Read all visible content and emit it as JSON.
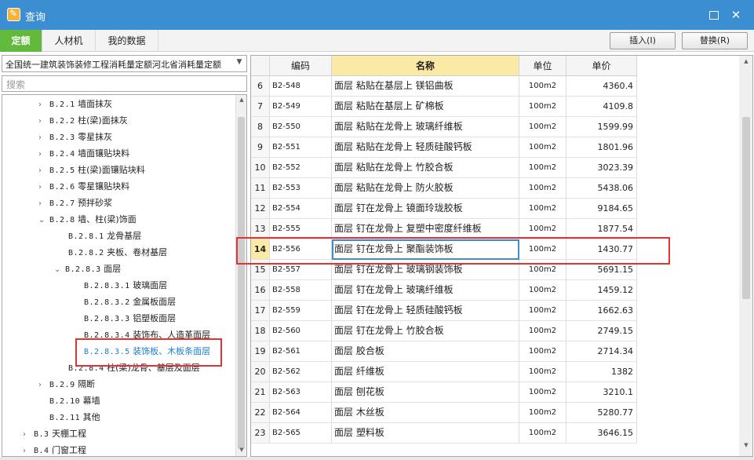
{
  "window": {
    "title": "查询"
  },
  "tabs": [
    {
      "label": "定额"
    },
    {
      "label": "人材机"
    },
    {
      "label": "我的数据"
    }
  ],
  "buttons": {
    "insert": "插入(I)",
    "replace": "替换(R)"
  },
  "combo": {
    "value": "全国统一建筑装饰装修工程消耗量定额河北省消耗量定额"
  },
  "search": {
    "placeholder": "搜索"
  },
  "tree": {
    "items": [
      {
        "code": "B.2.1",
        "label": "墙面抹灰"
      },
      {
        "code": "B.2.2",
        "label": "柱(梁)面抹灰"
      },
      {
        "code": "B.2.3",
        "label": "零星抹灰"
      },
      {
        "code": "B.2.4",
        "label": "墙面镶贴块料"
      },
      {
        "code": "B.2.5",
        "label": "柱(梁)面镶贴块料"
      },
      {
        "code": "B.2.6",
        "label": "零星镶贴块料"
      },
      {
        "code": "B.2.7",
        "label": "预拌砂浆"
      },
      {
        "code": "B.2.8",
        "label": "墙、柱(梁)饰面"
      },
      {
        "code": "B.2.8.1",
        "label": "龙骨基层"
      },
      {
        "code": "B.2.8.2",
        "label": "夹板、卷材基层"
      },
      {
        "code": "B.2.8.3",
        "label": "面层"
      },
      {
        "code": "B.2.8.3.1",
        "label": "玻璃面层"
      },
      {
        "code": "B.2.8.3.2",
        "label": "金属板面层"
      },
      {
        "code": "B.2.8.3.3",
        "label": "铝塑板面层"
      },
      {
        "code": "B.2.8.3.4",
        "label": "装饰布、人造革面层"
      },
      {
        "code": "B.2.8.3.5",
        "label": "装饰板、木板条面层"
      },
      {
        "code": "B.2.8.4",
        "label": "柱(梁)龙骨、基层及面层"
      },
      {
        "code": "B.2.9",
        "label": "隔断"
      },
      {
        "code": "B.2.10",
        "label": "幕墙"
      },
      {
        "code": "B.2.11",
        "label": "其他"
      },
      {
        "code": "B.3",
        "label": "天棚工程"
      },
      {
        "code": "B.4",
        "label": "门窗工程"
      }
    ]
  },
  "grid": {
    "headers": {
      "code": "编码",
      "name": "名称",
      "unit": "单位",
      "price": "单价"
    },
    "rows": [
      {
        "num": "6",
        "code": "B2-548",
        "name": "面层 粘贴在基层上 镁铝曲板",
        "unit": "100m2",
        "price": "4360.4"
      },
      {
        "num": "7",
        "code": "B2-549",
        "name": "面层 粘贴在基层上 矿棉板",
        "unit": "100m2",
        "price": "4109.8"
      },
      {
        "num": "8",
        "code": "B2-550",
        "name": "面层 粘贴在龙骨上 玻璃纤维板",
        "unit": "100m2",
        "price": "1599.99"
      },
      {
        "num": "9",
        "code": "B2-551",
        "name": "面层 粘贴在龙骨上 轻质硅酸钙板",
        "unit": "100m2",
        "price": "1801.96"
      },
      {
        "num": "10",
        "code": "B2-552",
        "name": "面层 粘贴在龙骨上 竹胶合板",
        "unit": "100m2",
        "price": "3023.39"
      },
      {
        "num": "11",
        "code": "B2-553",
        "name": "面层 粘贴在龙骨上 防火胶板",
        "unit": "100m2",
        "price": "5438.06"
      },
      {
        "num": "12",
        "code": "B2-554",
        "name": "面层 钉在龙骨上 镜面玲珑胶板",
        "unit": "100m2",
        "price": "9184.65"
      },
      {
        "num": "13",
        "code": "B2-555",
        "name": "面层 钉在龙骨上 复塑中密度纤维板",
        "unit": "100m2",
        "price": "1877.54"
      },
      {
        "num": "14",
        "code": "B2-556",
        "name": "面层 钉在龙骨上 聚酯装饰板",
        "unit": "100m2",
        "price": "1430.77"
      },
      {
        "num": "15",
        "code": "B2-557",
        "name": "面层 钉在龙骨上 玻璃钢装饰板",
        "unit": "100m2",
        "price": "5691.15"
      },
      {
        "num": "16",
        "code": "B2-558",
        "name": "面层 钉在龙骨上 玻璃纤维板",
        "unit": "100m2",
        "price": "1459.12"
      },
      {
        "num": "17",
        "code": "B2-559",
        "name": "面层 钉在龙骨上 轻质硅酸钙板",
        "unit": "100m2",
        "price": "1662.63"
      },
      {
        "num": "18",
        "code": "B2-560",
        "name": "面层 钉在龙骨上 竹胶合板",
        "unit": "100m2",
        "price": "2749.15"
      },
      {
        "num": "19",
        "code": "B2-561",
        "name": "面层 胶合板",
        "unit": "100m2",
        "price": "2714.34"
      },
      {
        "num": "20",
        "code": "B2-562",
        "name": "面层 纤维板",
        "unit": "100m2",
        "price": "1382"
      },
      {
        "num": "21",
        "code": "B2-563",
        "name": "面层 刨花板",
        "unit": "100m2",
        "price": "3210.1"
      },
      {
        "num": "22",
        "code": "B2-564",
        "name": "面层 木丝板",
        "unit": "100m2",
        "price": "5280.77"
      },
      {
        "num": "23",
        "code": "B2-565",
        "name": "面层 塑料板",
        "unit": "100m2",
        "price": "3646.15"
      }
    ]
  },
  "colors": {
    "titlebar": "#3c8ed2",
    "active_tab": "#63b93b",
    "header_highlight": "#fbe9a6",
    "annotation": "#e03434",
    "selected_tree": "#1a7fd0"
  }
}
